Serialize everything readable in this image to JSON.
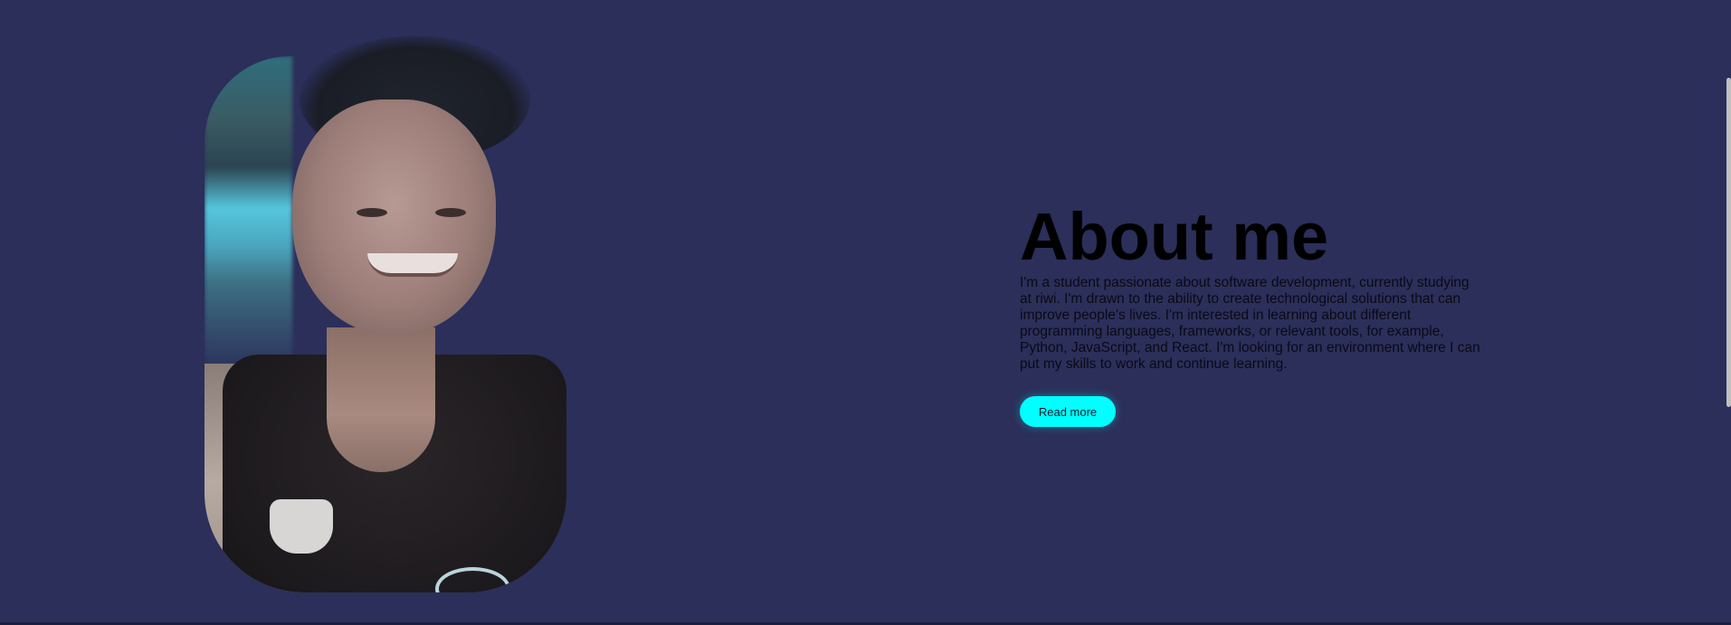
{
  "colors": {
    "background": "#2b2f5a",
    "accent": "#00ffff",
    "heading": "#000000"
  },
  "hero": {
    "portrait_alt": "profile photo"
  },
  "about": {
    "title": "About me",
    "description": "I'm a student passionate about software development, currently studying at riwi. I'm drawn to the ability to create technological solutions that can improve people's lives. I'm interested in learning about different programming languages, frameworks, or relevant tools, for example, Python, JavaScript, and React. I'm looking for an environment where I can put my skills to work and continue learning.",
    "button_label": "Read more"
  }
}
